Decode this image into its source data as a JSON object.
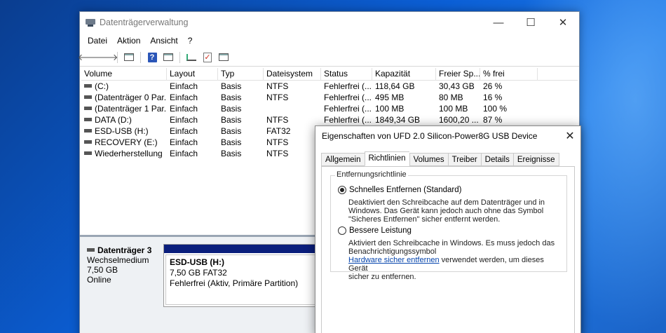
{
  "window": {
    "title": "Datenträgerverwaltung",
    "minimize": "—",
    "maximize": "☐",
    "close": "✕"
  },
  "menu": [
    "Datei",
    "Aktion",
    "Ansicht",
    "?"
  ],
  "toolbar": {
    "back_icon": "arrow-left-icon",
    "forward_icon": "arrow-right-icon",
    "help_glyph": "?"
  },
  "table": {
    "columns": [
      "Volume",
      "Layout",
      "Typ",
      "Dateisystem",
      "Status",
      "Kapazität",
      "Freier Sp...",
      "% frei"
    ],
    "rows": [
      {
        "volume": "(C:)",
        "layout": "Einfach",
        "typ": "Basis",
        "fs": "NTFS",
        "status": "Fehlerfrei (...",
        "cap": "118,64 GB",
        "free": "30,43 GB",
        "pct": "26 %"
      },
      {
        "volume": "(Datenträger 0 Par...",
        "layout": "Einfach",
        "typ": "Basis",
        "fs": "NTFS",
        "status": "Fehlerfrei (...",
        "cap": "495 MB",
        "free": "80 MB",
        "pct": "16 %"
      },
      {
        "volume": "(Datenträger 1 Par...",
        "layout": "Einfach",
        "typ": "Basis",
        "fs": "",
        "status": "Fehlerfrei (...",
        "cap": "100 MB",
        "free": "100 MB",
        "pct": "100 %"
      },
      {
        "volume": "DATA (D:)",
        "layout": "Einfach",
        "typ": "Basis",
        "fs": "NTFS",
        "status": "Fehlerfrei (...",
        "cap": "1849,34 GB",
        "free": "1600,20 ...",
        "pct": "87 %"
      },
      {
        "volume": "ESD-USB (H:)",
        "layout": "Einfach",
        "typ": "Basis",
        "fs": "FAT32",
        "status": "",
        "cap": "",
        "free": "",
        "pct": ""
      },
      {
        "volume": "RECOVERY (E:)",
        "layout": "Einfach",
        "typ": "Basis",
        "fs": "NTFS",
        "status": "",
        "cap": "",
        "free": "",
        "pct": ""
      },
      {
        "volume": "Wiederherstellung",
        "layout": "Einfach",
        "typ": "Basis",
        "fs": "NTFS",
        "status": "",
        "cap": "",
        "free": "",
        "pct": ""
      }
    ]
  },
  "disk": {
    "name": "Datenträger 3",
    "type": "Wechselmedium",
    "size": "7,50 GB",
    "state": "Online",
    "partition": {
      "name": "ESD-USB  (H:)",
      "size": "7,50 GB FAT32",
      "status": "Fehlerfrei (Aktiv, Primäre Partition)"
    }
  },
  "dialog": {
    "title": "Eigenschaften von UFD 2.0 Silicon-Power8G USB Device",
    "close": "✕",
    "tabs": [
      "Allgemein",
      "Richtlinien",
      "Volumes",
      "Treiber",
      "Details",
      "Ereignisse"
    ],
    "active_tab": "Richtlinien",
    "group_label": "Entfernungsrichtlinie",
    "option1": {
      "label": "Schnelles Entfernen (Standard)",
      "selected": true,
      "desc_lines": [
        "Deaktiviert den Schreibcache auf dem Datenträger und in",
        "Windows. Das Gerät kann jedoch auch ohne das Symbol",
        "\"Sicheres Entfernen\" sicher entfernt werden."
      ]
    },
    "option2": {
      "label": "Bessere Leistung",
      "selected": false,
      "desc_lines": [
        "Aktiviert den Schreibcache in Windows. Es muss jedoch das",
        "Benachrichtigungssymbol"
      ],
      "link": "Hardware sicher entfernen",
      "after_link": " verwendet werden, um dieses Gerät",
      "last_line": "sicher zu entfernen."
    }
  }
}
